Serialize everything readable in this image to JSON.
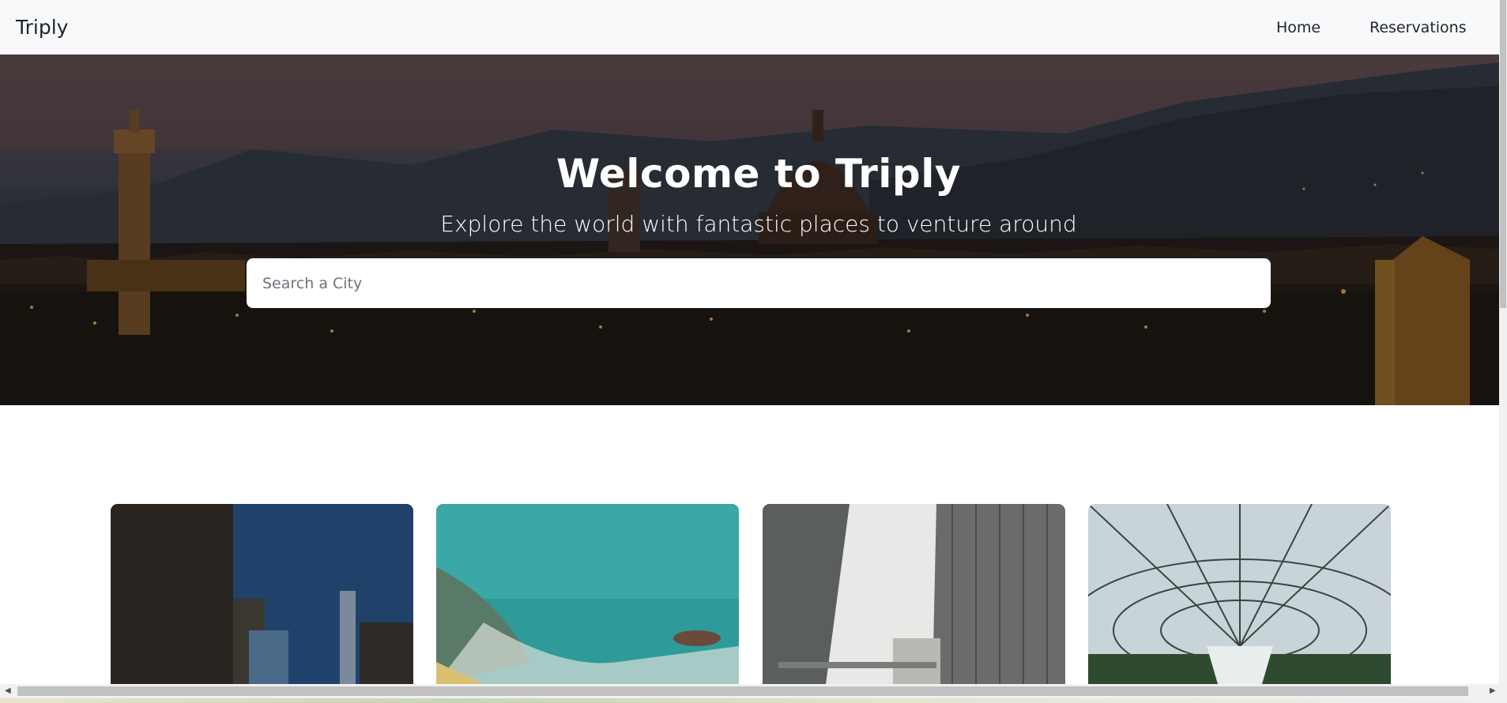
{
  "navbar": {
    "brand": "Triply",
    "links": [
      "Home",
      "Reservations"
    ]
  },
  "hero": {
    "title": "Welcome to Triply",
    "subtitle": "Explore the world with fantastic places to venture around",
    "search_placeholder": "Search a City"
  },
  "cards": [
    {
      "image": "night-city-street-photo"
    },
    {
      "image": "aerial-ocean-coast-photo"
    },
    {
      "image": "office-skyscrapers-photo"
    },
    {
      "image": "glass-dome-waterfall-photo"
    }
  ],
  "colors": {
    "navbar_bg": "#f8f9fa",
    "text_dark": "#212529",
    "hero_text": "#ffffff"
  }
}
